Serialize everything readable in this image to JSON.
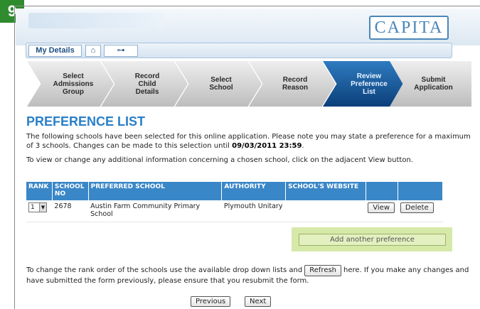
{
  "step_badge": "9",
  "header": {
    "logo": "CAPITA"
  },
  "topnav": {
    "my_details": "My Details",
    "home_icon": "⌂",
    "key_icon": "⊶"
  },
  "steps": [
    {
      "label": "Select\nAdmissions\nGroup",
      "active": false
    },
    {
      "label": "Record\nChild\nDetails",
      "active": false
    },
    {
      "label": "Select\nSchool",
      "active": false
    },
    {
      "label": "Record\nReason",
      "active": false
    },
    {
      "label": "Review\nPreference\nList",
      "active": true
    },
    {
      "label": "Submit\nApplication",
      "active": false
    }
  ],
  "page_title": "PREFERENCE LIST",
  "intro": {
    "text": "The following schools have been selected for this online application.  Please note you may state a preference for a maximum of 3 schools. Changes can be made to this selection until ",
    "deadline": "09/03/2011 23:59",
    "end": "."
  },
  "view_note": "To view or change any additional information concerning a chosen school, click on the adjacent View button.",
  "table": {
    "headers": [
      "RANK",
      "SCHOOL NO",
      "PREFERRED SCHOOL",
      "AUTHORITY",
      "SCHOOL'S WEBSITE",
      "",
      ""
    ],
    "rows": [
      {
        "rank": "1",
        "school_no": "2678",
        "school": "Austin Farm Community Primary School",
        "authority": "Plymouth Unitary",
        "website": "",
        "view": "View",
        "delete": "Delete"
      }
    ]
  },
  "add_preference": "Add another preference",
  "rank_note": {
    "before": "To change the rank order of the schools use the available drop down lists and",
    "refresh": "Refresh",
    "after": "here. If you make any changes and have submitted the form previously, please ensure that you resubmit the form."
  },
  "nav": {
    "previous": "Previous",
    "next": "Next"
  }
}
